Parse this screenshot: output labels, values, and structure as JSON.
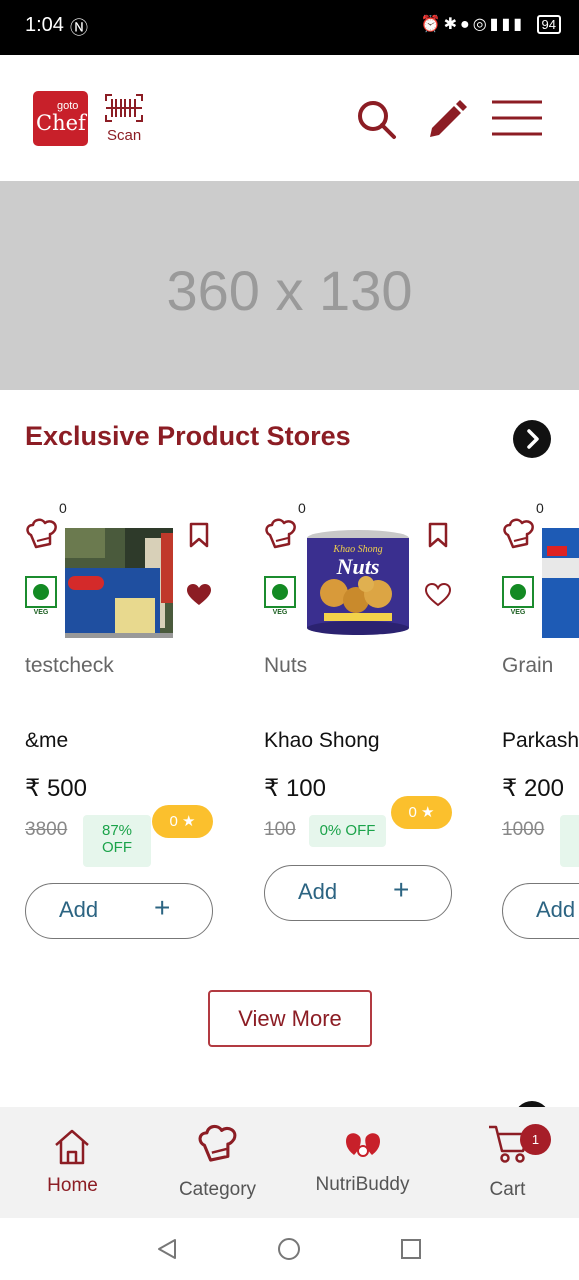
{
  "status_bar": {
    "time": "1:04",
    "battery": "94"
  },
  "header": {
    "logo_top": "goto",
    "logo_bottom": "Chef",
    "scan_label": "Scan"
  },
  "banner": {
    "placeholder_text": "360 x 130"
  },
  "section": {
    "title": "Exclusive Product Stores"
  },
  "products": [
    {
      "count": "0",
      "category": "testcheck",
      "brand": "&me",
      "price": "₹ 500",
      "mrp": "3800",
      "discount": "87%\nOFF",
      "rating": "0 ★",
      "add_label": "Add",
      "veg_label": "VEG",
      "favorited": true
    },
    {
      "count": "0",
      "category": "Nuts",
      "brand": "Khao Shong",
      "price": "₹ 100",
      "mrp": "100",
      "discount": "0% OFF",
      "rating": "0 ★",
      "add_label": "Add",
      "veg_label": "VEG",
      "image_text": "Khao Shong",
      "image_title": "Nuts",
      "favorited": false
    },
    {
      "count": "0",
      "category": "Grain",
      "brand": "Parkash",
      "price": "₹ 200",
      "mrp": "1000",
      "add_label": "Add",
      "veg_label": "VEG"
    }
  ],
  "view_more_label": "View More",
  "bottom_nav": {
    "home": "Home",
    "category": "Category",
    "nutribuddy": "NutriBuddy",
    "cart": "Cart",
    "cart_count": "1"
  },
  "colors": {
    "brand": "#8c1d24",
    "logo": "#c8202a",
    "veg": "#138a23",
    "rating": "#fbc02d",
    "discount_text": "#1ba34a",
    "add_text": "#2c6482"
  }
}
